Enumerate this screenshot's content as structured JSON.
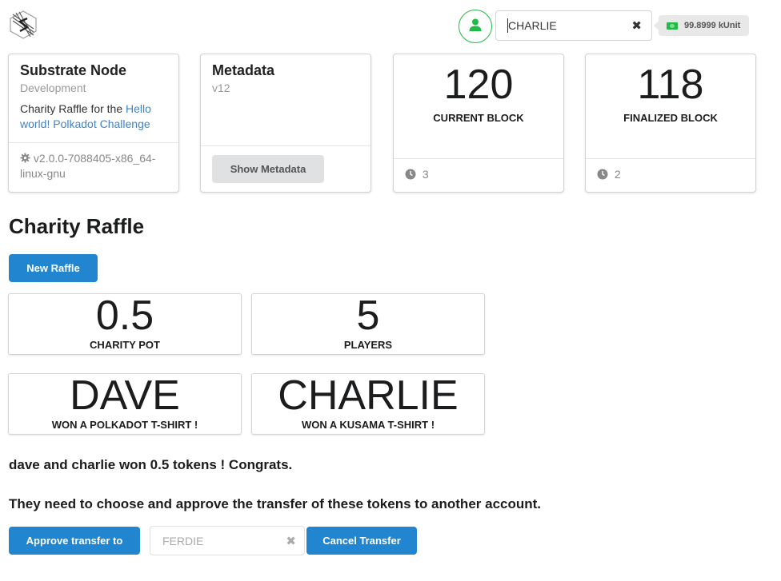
{
  "header": {
    "account": {
      "value": "CHARLIE"
    },
    "balance": "99.8999 kUnit"
  },
  "cards": {
    "node": {
      "title": "Substrate Node",
      "meta": "Development",
      "desc_prefix": "Charity Raffle for the ",
      "desc_link": "Hello world! Polkadot Challenge",
      "version": "v2.0.0-7088405-x86_64-linux-gnu"
    },
    "metadata": {
      "title": "Metadata",
      "version": "v12",
      "button": "Show Metadata"
    },
    "current_block": {
      "value": "120",
      "label": "CURRENT BLOCK",
      "timer": "3"
    },
    "finalized_block": {
      "value": "118",
      "label": "FINALIZED BLOCK",
      "timer": "2"
    }
  },
  "raffle": {
    "title": "Charity Raffle",
    "new_button": "New Raffle",
    "pot": {
      "value": "0.5",
      "label": "CHARITY POT"
    },
    "players": {
      "value": "5",
      "label": "PLAYERS"
    },
    "winner1": {
      "value": "DAVE",
      "label": "WON A POLKADOT T-SHIRT !"
    },
    "winner2": {
      "value": "CHARLIE",
      "label": "WON A KUSAMA T-SHIRT !"
    },
    "message1": "dave and charlie won 0.5 tokens ! Congrats.",
    "message2": "They need to choose and approve the transfer of these tokens to another account.",
    "approve_button": "Approve transfer to",
    "transfer_target": "FERDIE",
    "cancel_button": "Cancel Transfer"
  },
  "colors": {
    "primary": "#2185d0",
    "success": "#21ba45",
    "link": "#4183c4"
  }
}
